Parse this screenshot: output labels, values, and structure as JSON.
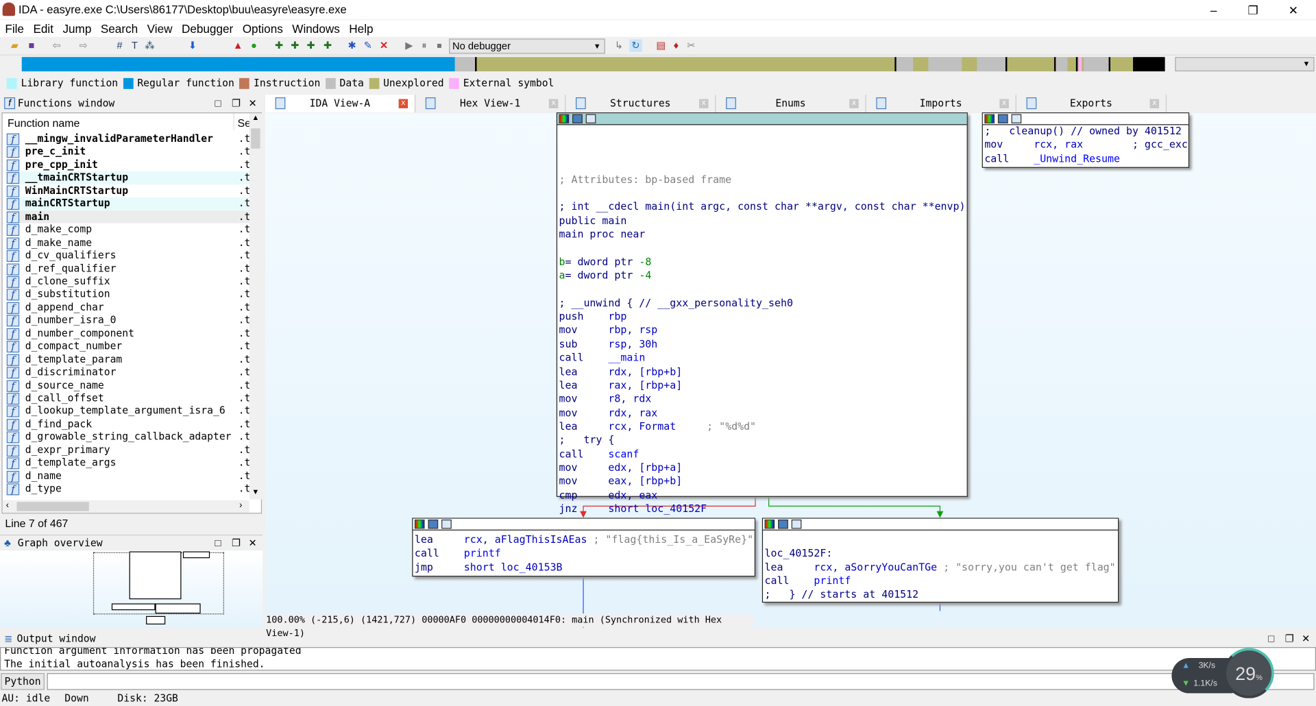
{
  "window": {
    "title": "IDA - easyre.exe C:\\Users\\86177\\Desktop\\buu\\easyre\\easyre.exe",
    "minimize": "–",
    "maximize": "❐",
    "close": "✕"
  },
  "menu": [
    "File",
    "Edit",
    "Jump",
    "Search",
    "View",
    "Debugger",
    "Options",
    "Windows",
    "Help"
  ],
  "toolbar": {
    "debugger_select": "No debugger"
  },
  "legend": [
    {
      "label": "Library function",
      "color": "#b0f4fc"
    },
    {
      "label": "Regular function",
      "color": "#0096e0"
    },
    {
      "label": "Instruction",
      "color": "#c07858"
    },
    {
      "label": "Data",
      "color": "#c0c0c0"
    },
    {
      "label": "Unexplored",
      "color": "#b5b56e"
    },
    {
      "label": "External symbol",
      "color": "#fcb0fc"
    }
  ],
  "colors": {
    "regular": "#0096e0",
    "unexplored": "#b5b56e",
    "data": "#c0c0c0",
    "external": "#fcb0fc"
  },
  "functions_window": {
    "title": "Functions window",
    "col_name": "Function name",
    "col_seg": "Se",
    "line_status": "Line 7 of 467",
    "rows": [
      {
        "name": "__mingw_invalidParameterHandler",
        "seg": ".t",
        "bold": true
      },
      {
        "name": "pre_c_init",
        "seg": ".t",
        "bold": true
      },
      {
        "name": "pre_cpp_init",
        "seg": ".t",
        "bold": true
      },
      {
        "name": "__tmainCRTStartup",
        "seg": ".t",
        "bold": true,
        "lib": true
      },
      {
        "name": "WinMainCRTStartup",
        "seg": ".t",
        "bold": true
      },
      {
        "name": "mainCRTStartup",
        "seg": ".t",
        "bold": true,
        "lib": true
      },
      {
        "name": "main",
        "seg": ".t",
        "bold": true,
        "selected": true
      },
      {
        "name": "d_make_comp",
        "seg": ".t"
      },
      {
        "name": "d_make_name",
        "seg": ".t"
      },
      {
        "name": "d_cv_qualifiers",
        "seg": ".t"
      },
      {
        "name": "d_ref_qualifier",
        "seg": ".t"
      },
      {
        "name": "d_clone_suffix",
        "seg": ".t"
      },
      {
        "name": "d_substitution",
        "seg": ".t"
      },
      {
        "name": "d_append_char",
        "seg": ".t"
      },
      {
        "name": "d_number_isra_0",
        "seg": ".t"
      },
      {
        "name": "d_number_component",
        "seg": ".t"
      },
      {
        "name": "d_compact_number",
        "seg": ".t"
      },
      {
        "name": "d_template_param",
        "seg": ".t"
      },
      {
        "name": "d_discriminator",
        "seg": ".t"
      },
      {
        "name": "d_source_name",
        "seg": ".t"
      },
      {
        "name": "d_call_offset",
        "seg": ".t"
      },
      {
        "name": "d_lookup_template_argument_isra_6",
        "seg": ".t"
      },
      {
        "name": "d_find_pack",
        "seg": ".t"
      },
      {
        "name": "d_growable_string_callback_adapter",
        "seg": ".t"
      },
      {
        "name": "d_expr_primary",
        "seg": ".t"
      },
      {
        "name": "d_template_args",
        "seg": ".t"
      },
      {
        "name": "d_name",
        "seg": ".t"
      },
      {
        "name": "d_type",
        "seg": ".t"
      }
    ]
  },
  "graph_overview": {
    "title": "Graph overview"
  },
  "tabs": [
    {
      "label": "IDA View-A",
      "active": true
    },
    {
      "label": "Hex View-1"
    },
    {
      "label": "Structures"
    },
    {
      "label": "Enums"
    },
    {
      "label": "Imports"
    },
    {
      "label": "Exports"
    }
  ],
  "blocks": {
    "main": [
      [],
      [],
      [
        [
          "; Attributes: bp-based frame",
          "cm"
        ]
      ],
      [],
      [
        [
          "; int __cdecl main(int argc, const char **argv, const char **envp)",
          "tx"
        ]
      ],
      [
        [
          "public main",
          "tx"
        ]
      ],
      [
        [
          "main proc near",
          "tx"
        ]
      ],
      [],
      [
        [
          "b",
          "vr"
        ],
        [
          "= dword ptr ",
          "tx"
        ],
        [
          "-8",
          "vr"
        ]
      ],
      [
        [
          "a",
          "vr"
        ],
        [
          "= dword ptr ",
          "tx"
        ],
        [
          "-4",
          "vr"
        ]
      ],
      [],
      [
        [
          "; __unwind { // __gxx_personality_seh0",
          "tx"
        ]
      ],
      [
        [
          "push    ",
          "mn"
        ],
        [
          "rbp",
          "op"
        ]
      ],
      [
        [
          "mov     ",
          "mn"
        ],
        [
          "rbp, rsp",
          "op"
        ]
      ],
      [
        [
          "sub     ",
          "mn"
        ],
        [
          "rsp, 30h",
          "op"
        ]
      ],
      [
        [
          "call    ",
          "mn"
        ],
        [
          "__main",
          "nm"
        ]
      ],
      [
        [
          "lea     ",
          "mn"
        ],
        [
          "rdx, [rbp+b]",
          "op"
        ]
      ],
      [
        [
          "lea     ",
          "mn"
        ],
        [
          "rax, [rbp+a]",
          "op"
        ]
      ],
      [
        [
          "mov     ",
          "mn"
        ],
        [
          "r8, rdx",
          "op"
        ]
      ],
      [
        [
          "mov     ",
          "mn"
        ],
        [
          "rdx, rax",
          "op"
        ]
      ],
      [
        [
          "lea     ",
          "mn"
        ],
        [
          "rcx, Format",
          "op"
        ],
        [
          "     ; \"%d%d\"",
          "cm"
        ]
      ],
      [
        [
          ";   try {",
          "tx"
        ]
      ],
      [
        [
          "call    ",
          "mn"
        ],
        [
          "scanf",
          "nm"
        ]
      ],
      [
        [
          "mov     ",
          "mn"
        ],
        [
          "edx, [rbp+a]",
          "op"
        ]
      ],
      [
        [
          "mov     ",
          "mn"
        ],
        [
          "eax, [rbp+b]",
          "op"
        ]
      ],
      [
        [
          "cmp     ",
          "mn"
        ],
        [
          "edx, eax",
          "op"
        ]
      ],
      [
        [
          "jnz     ",
          "mn"
        ],
        [
          "short loc_40152F",
          "op"
        ]
      ]
    ],
    "cleanup": [
      [
        [
          ";   cleanup() // owned by 401512",
          "tx"
        ]
      ],
      [
        [
          "mov     ",
          "mn"
        ],
        [
          "rcx, rax",
          "op"
        ],
        [
          "        ; gcc_exc",
          "tx"
        ]
      ],
      [
        [
          "call    ",
          "mn"
        ],
        [
          "_Unwind_Resume",
          "nm"
        ]
      ]
    ],
    "success": [
      [
        [
          "lea     ",
          "mn"
        ],
        [
          "rcx, aFlagThisIsAEas",
          "op"
        ],
        [
          " ; \"flag{this_Is_a_EaSyRe}\"",
          "cm"
        ]
      ],
      [
        [
          "call    ",
          "mn"
        ],
        [
          "printf",
          "nm"
        ]
      ],
      [
        [
          "jmp     ",
          "mn"
        ],
        [
          "short loc_40153B",
          "op"
        ]
      ]
    ],
    "fail": [
      [],
      [
        [
          "loc_40152F:",
          "tx"
        ]
      ],
      [
        [
          "lea     ",
          "mn"
        ],
        [
          "rcx, aSorryYouCanTGe",
          "op"
        ],
        [
          " ; \"sorry,you can't get flag\"",
          "cm"
        ]
      ],
      [
        [
          "call    ",
          "mn"
        ],
        [
          "printf",
          "nm"
        ]
      ],
      [
        [
          ";   } // starts at 401512",
          "tx"
        ]
      ]
    ]
  },
  "status_line": "100.00% (-215,6) (1421,727) 00000AF0 00000000004014F0: main (Synchronized with Hex View-1)",
  "output": {
    "title": "Output window",
    "lines": [
      "Function argument information has been propagated",
      "The initial autoanalysis has been finished."
    ],
    "python_button": "Python"
  },
  "statusbar": {
    "au": "AU:  idle",
    "dir": "Down",
    "disk": "Disk: 23GB"
  },
  "netwidget": {
    "up": "3K/s",
    "down": "1.1K/s",
    "percent": "29"
  }
}
